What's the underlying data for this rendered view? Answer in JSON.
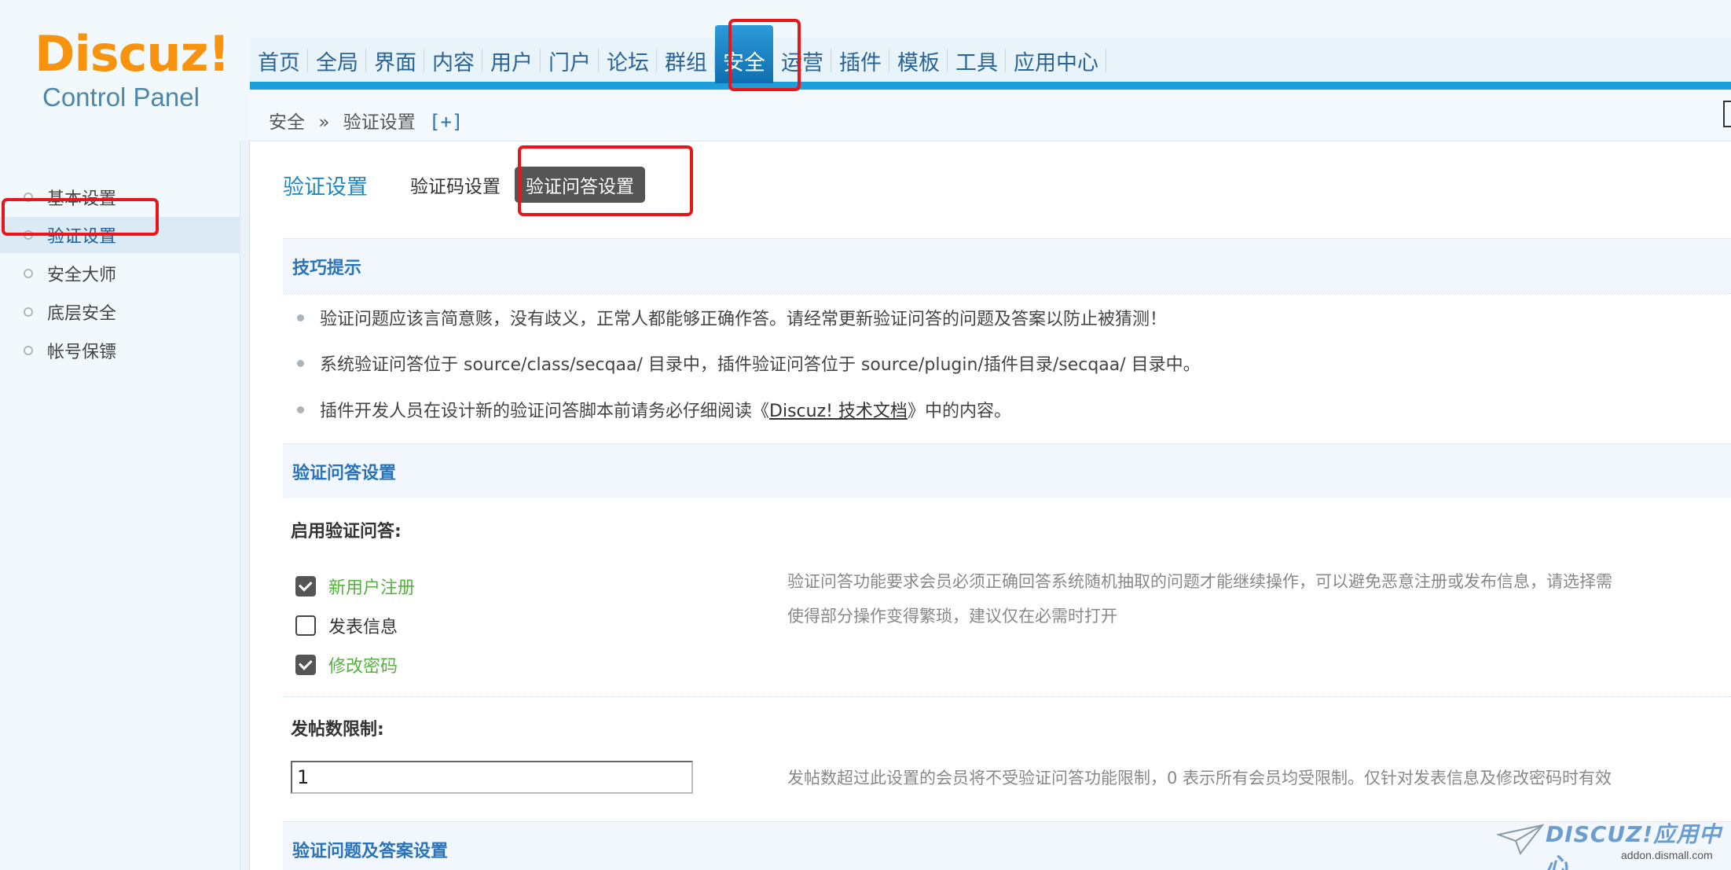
{
  "logo": {
    "word": "Discuz!",
    "sub": "Control Panel"
  },
  "nav": {
    "items": [
      "首页",
      "全局",
      "界面",
      "内容",
      "用户",
      "门户",
      "论坛",
      "群组",
      "安全",
      "运营",
      "插件",
      "模板",
      "工具",
      "应用中心"
    ],
    "active": "安全"
  },
  "breadcrumb": {
    "section": "安全",
    "sep": "»",
    "page": "验证设置",
    "plus": "[+]"
  },
  "sidebar": {
    "items": [
      {
        "label": "基本设置"
      },
      {
        "label": "验证设置"
      },
      {
        "label": "安全大师"
      },
      {
        "label": "底层安全"
      },
      {
        "label": "帐号保镖"
      }
    ],
    "active_index": 1
  },
  "main": {
    "title": "验证设置",
    "tabs": [
      {
        "label": "验证码设置"
      },
      {
        "label": "验证问答设置"
      }
    ],
    "active_tab": 1
  },
  "tips": {
    "heading": "技巧提示",
    "line1": "验证问题应该言简意赅，没有歧义，正常人都能够正确作答。请经常更新验证问答的问题及答案以防止被猜测！",
    "line2": "系统验证问答位于 source/class/secqaa/ 目录中，插件验证问答位于 source/plugin/插件目录/secqaa/ 目录中。",
    "line3_pre": "插件开发人员在设计新的验证问答脚本前请务必仔细阅读《 ",
    "line3_link": "Discuz! 技术文档",
    "line3_post": " 》中的内容。"
  },
  "secqaa": {
    "heading": "验证问答设置",
    "enable_label": "启用验证问答:",
    "options": [
      {
        "label": "新用户注册",
        "checked": true
      },
      {
        "label": "发表信息",
        "checked": false
      },
      {
        "label": "修改密码",
        "checked": true
      }
    ],
    "enable_desc_1": "验证问答功能要求会员必须正确回答系统随机抽取的问题才能继续操作，可以避免恶意注册或发布信息，请选择需",
    "enable_desc_2": "使得部分操作变得繁琐，建议仅在必需时打开",
    "post_limit_label": "发帖数限制:",
    "post_limit_value": "1",
    "post_limit_desc": "发帖数超过此设置的会员将不受验证问答功能限制，0 表示所有会员均受限制。仅针对发表信息及修改密码时有效",
    "qa_heading": "验证问题及答案设置"
  },
  "watermark": {
    "brand": "DISCUZ!应用中心",
    "url": "addon.dismall.com"
  },
  "colors": {
    "nav_active": "#1679bd",
    "accent": "#1e9fd9",
    "highlight": "#e8161b",
    "checked_label": "#54b33c"
  }
}
